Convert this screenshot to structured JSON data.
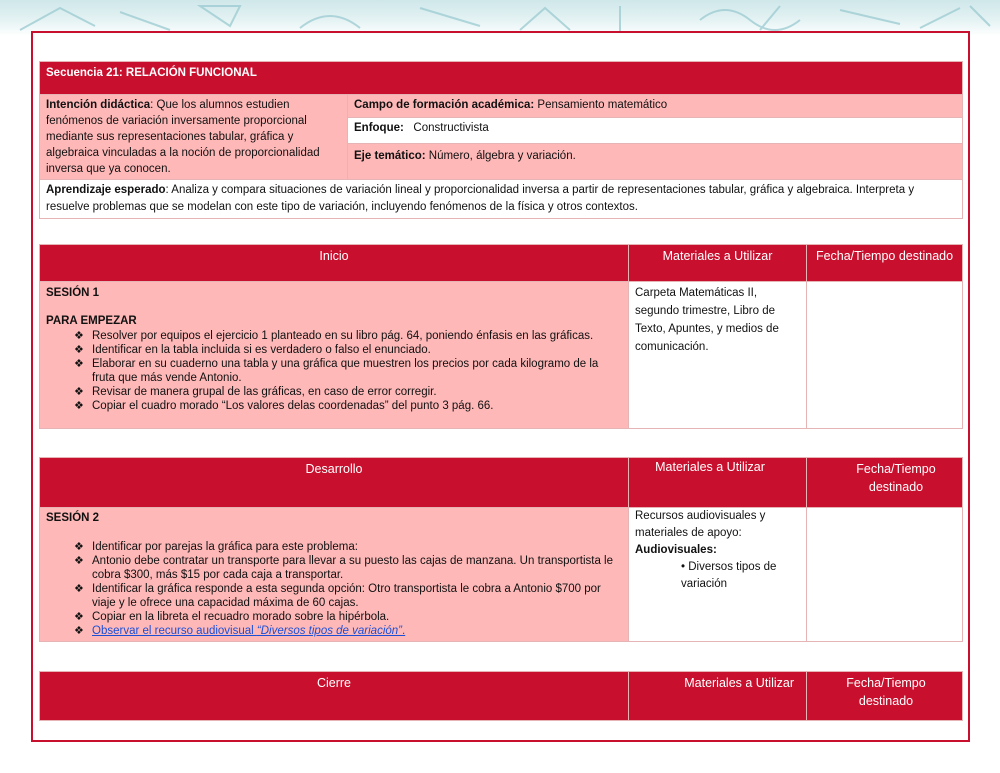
{
  "seq": {
    "title": "Secuencia 21: RELACIÓN FUNCIONAL",
    "intencion_label": "Intención didáctica",
    "intencion_text": ": Que los alumnos estudien fenómenos de variación inversamente proporcional mediante sus representaciones tabular, gráfica y algebraica vinculadas a la noción de proporcionalidad inversa que ya conocen.",
    "campo_label": "Campo de formación académica:",
    "campo_text": " Pensamiento matemático",
    "enfoque_label": "Enfoque:",
    "enfoque_text": "   Constructivista",
    "eje_label": "Eje temático:",
    "eje_text": " Número, álgebra y variación.",
    "aprendizaje_label": "Aprendizaje esperado",
    "aprendizaje_text": ": Analiza y compara situaciones de variación lineal y proporcionalidad inversa a partir de representaciones tabular, gráfica y algebraica. Interpreta y resuelve problemas que se modelan con este tipo de variación, incluyendo fenómenos de la física y otros contextos."
  },
  "inicio": {
    "header": "Inicio",
    "materiales_header": "Materiales a Utilizar",
    "fecha_header": "Fecha/Tiempo destinado",
    "session": "SESIÓN 1",
    "subtitle": "PARA EMPEZAR",
    "items": [
      "Resolver por equipos el ejercicio 1 planteado en su libro pág. 64, poniendo énfasis en las gráficas.",
      "Identificar en la tabla incluida si es verdadero o falso el enunciado.",
      "Elaborar en su cuaderno una tabla y una gráfica que muestren los precios por cada kilogramo de la fruta que más vende Antonio.",
      "Revisar de manera grupal de las gráficas, en caso de error corregir.",
      "Copiar el cuadro morado “Los valores delas coordenadas” del punto 3 pág. 66."
    ],
    "materiales": "Carpeta Matemáticas II, segundo trimestre, Libro de Texto, Apuntes, y medios de comunicación."
  },
  "desarrollo": {
    "header": "Desarrollo",
    "materiales_header": "Materiales a Utilizar",
    "fecha_header": "Fecha/Tiempo destinado",
    "session": "SESIÓN 2",
    "items": [
      "Identificar por parejas la gráfica para este problema:",
      "Antonio debe contratar un transporte para llevar a su puesto las cajas de manzana. Un transportista le cobra $300, más $15 por cada caja a transportar.",
      "Identificar la gráfica responde a esta segunda opción: Otro transportista le cobra a Antonio $700 por viaje y le ofrece una capacidad máxima de 60 cajas.",
      "Copiar en la libreta el recuadro morado sobre la hipérbola."
    ],
    "link_prefix": "Observar el recurso audiovisual ",
    "link_title": "“Diversos tipos de variación”",
    "link_suffix": ".",
    "materiales_line1": "Recursos audiovisuales y materiales de apoyo:",
    "materiales_line2": "Audiovisuales:",
    "materiales_sub": "• Diversos tipos de variación"
  },
  "cierre": {
    "header": "Cierre",
    "materiales_header": "Materiales a Utilizar",
    "fecha_header": "Fecha/Tiempo destinado"
  },
  "colors": {
    "primary_red": "#c8102e",
    "pink": "#ffb8b8",
    "link": "#1a4fd6"
  },
  "icons": {
    "bullet": "❖"
  }
}
